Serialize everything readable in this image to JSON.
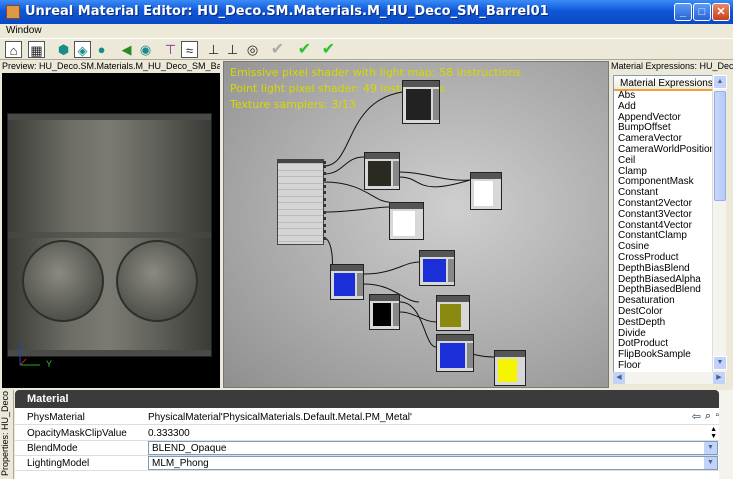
{
  "window": {
    "title": "Unreal Material Editor: HU_Deco.SM.Materials.M_HU_Deco_SM_Barrel01"
  },
  "menu": {
    "items": [
      "Window"
    ]
  },
  "preview": {
    "title": "Preview: HU_Deco.SM.Materials.M_HU_Deco_SM_Barre",
    "axis_y_label": "Y"
  },
  "graph": {
    "stats": [
      "Emissive pixel shader with light map: 58 instructions",
      "Point light pixel shader: 49 instructions",
      "Texture samplers: 3/13"
    ]
  },
  "expressions": {
    "panel_title": "Material Expressions: HU_Deco",
    "column_header": "Material Expressions",
    "items": [
      "Abs",
      "Add",
      "AppendVector",
      "BumpOffset",
      "CameraVector",
      "CameraWorldPosition",
      "Ceil",
      "Clamp",
      "ComponentMask",
      "Constant",
      "Constant2Vector",
      "Constant3Vector",
      "Constant4Vector",
      "ConstantClamp",
      "Cosine",
      "CrossProduct",
      "DepthBiasBlend",
      "DepthBiasedAlpha",
      "DepthBiasedBlend",
      "Desaturation",
      "DestColor",
      "DestDepth",
      "Divide",
      "DotProduct",
      "FlipBookSample",
      "Floor"
    ]
  },
  "properties": {
    "tab_label": "Properties: HU_Deco",
    "category": "Material",
    "rows": [
      {
        "name": "PhysMaterial",
        "value": "PhysicalMaterial'PhysicalMaterials.Default.Metal.PM_Metal'"
      },
      {
        "name": "OpacityMaskClipValue",
        "value": "0.333300"
      },
      {
        "name": "BlendMode",
        "value": "BLEND_Opaque"
      },
      {
        "name": "LightingModel",
        "value": "MLM_Phong"
      }
    ]
  },
  "colors": {
    "stats_text": "#d8d800",
    "apply_check": "#2fbf2f"
  }
}
